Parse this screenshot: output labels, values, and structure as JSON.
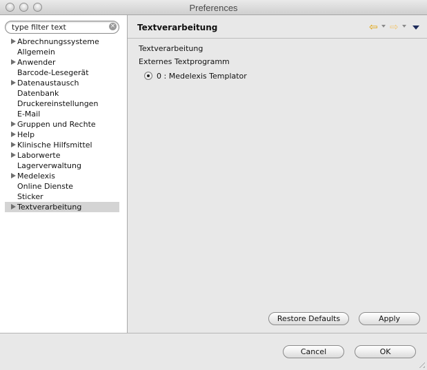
{
  "window": {
    "title": "Preferences"
  },
  "search": {
    "placeholder": "type filter text",
    "clear_icon": "×"
  },
  "tree": {
    "items": [
      {
        "label": "Abrechnungssysteme",
        "expandable": true
      },
      {
        "label": "Allgemein",
        "expandable": false
      },
      {
        "label": "Anwender",
        "expandable": true
      },
      {
        "label": "Barcode-Lesegerät",
        "expandable": false
      },
      {
        "label": "Datenaustausch",
        "expandable": true
      },
      {
        "label": "Datenbank",
        "expandable": false
      },
      {
        "label": "Druckereinstellungen",
        "expandable": false
      },
      {
        "label": "E-Mail",
        "expandable": false
      },
      {
        "label": "Gruppen und Rechte",
        "expandable": true
      },
      {
        "label": "Help",
        "expandable": true
      },
      {
        "label": "Klinische Hilfsmittel",
        "expandable": true
      },
      {
        "label": "Laborwerte",
        "expandable": true
      },
      {
        "label": "Lagerverwaltung",
        "expandable": false
      },
      {
        "label": "Medelexis",
        "expandable": true
      },
      {
        "label": "Online Dienste",
        "expandable": false
      },
      {
        "label": "Sticker",
        "expandable": false
      },
      {
        "label": "Textverarbeitung",
        "expandable": true,
        "selected": true
      }
    ]
  },
  "page": {
    "title": "Textverarbeitung",
    "section_label": "Textverarbeitung",
    "program_label": "Externes Textprogramm",
    "option_label": "0 : Medelexis Templator",
    "option_selected": true
  },
  "nav": {
    "back_icon": "⇦",
    "forward_icon": "⇨"
  },
  "buttons": {
    "restore_defaults": "Restore Defaults",
    "apply": "Apply",
    "cancel": "Cancel",
    "ok": "OK"
  },
  "colors": {
    "selected_row": "#d4d4d4",
    "back_arrow": "#e0a000",
    "menu_arrow": "#1c2a5a"
  }
}
